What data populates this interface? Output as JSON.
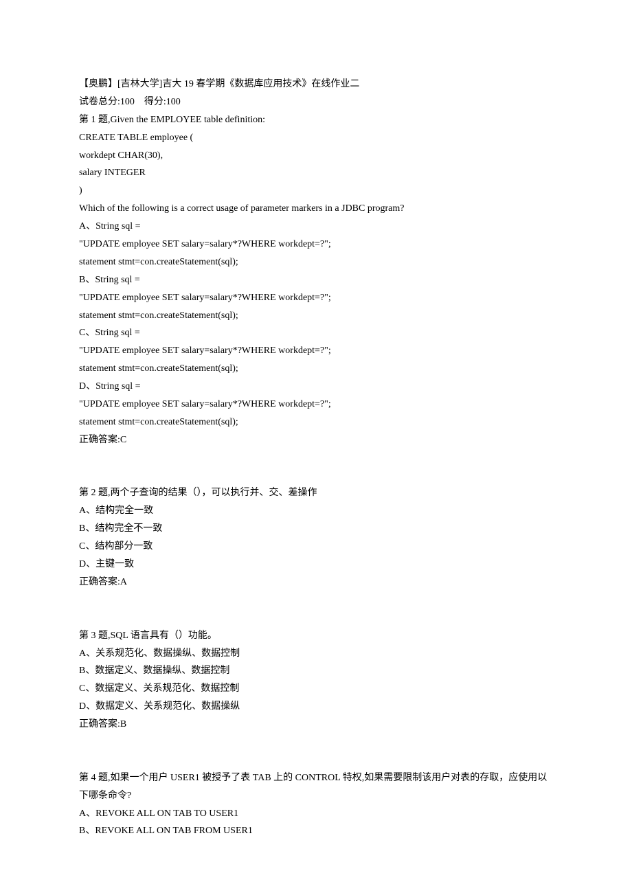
{
  "header": {
    "title": "【奥鹏】[吉林大学]吉大 19 春学期《数据库应用技术》在线作业二",
    "score_line": "试卷总分:100    得分:100"
  },
  "q1": {
    "prompt_l1": "第 1 题,Given the EMPLOYEE table definition:",
    "prompt_l2": "CREATE TABLE employee (",
    "prompt_l3": "workdept CHAR(30),",
    "prompt_l4": "salary INTEGER",
    "prompt_l5": ")",
    "prompt_l6": "Which of the following is a correct usage of parameter markers in a JDBC program?",
    "a_l1": "A、String sql =",
    "a_l2": "\"UPDATE employee SET salary=salary*?WHERE workdept=?\";",
    "a_l3": "statement stmt=con.createStatement(sql);",
    "b_l1": "B、String sql =",
    "b_l2": "\"UPDATE employee SET salary=salary*?WHERE workdept=?\";",
    "b_l3": "statement stmt=con.createStatement(sql);",
    "c_l1": "C、String sql =",
    "c_l2": "\"UPDATE employee SET salary=salary*?WHERE workdept=?\";",
    "c_l3": "statement stmt=con.createStatement(sql);",
    "d_l1": "D、String sql =",
    "d_l2": "\"UPDATE employee SET salary=salary*?WHERE workdept=?\";",
    "d_l3": "statement stmt=con.createStatement(sql);",
    "answer": "正确答案:C"
  },
  "q2": {
    "prompt": "第 2 题,两个子查询的结果（），可以执行并、交、差操作",
    "a": "A、结构完全一致",
    "b": "B、结构完全不一致",
    "c": "C、结构部分一致",
    "d": "D、主键一致",
    "answer": "正确答案:A"
  },
  "q3": {
    "prompt": "第 3 题,SQL 语言具有（）功能。",
    "a": "A、关系规范化、数据操纵、数据控制",
    "b": "B、数据定义、数据操纵、数据控制",
    "c": "C、数据定义、关系规范化、数据控制",
    "d": "D、数据定义、关系规范化、数据操纵",
    "answer": "正确答案:B"
  },
  "q4": {
    "prompt": "第 4 题,如果一个用户 USER1 被授予了表 TAB 上的 CONTROL 特权,如果需要限制该用户对表的存取，应使用以下哪条命令?",
    "a": "A、REVOKE ALL ON TAB TO USER1",
    "b": "B、REVOKE ALL ON TAB FROM USER1"
  }
}
